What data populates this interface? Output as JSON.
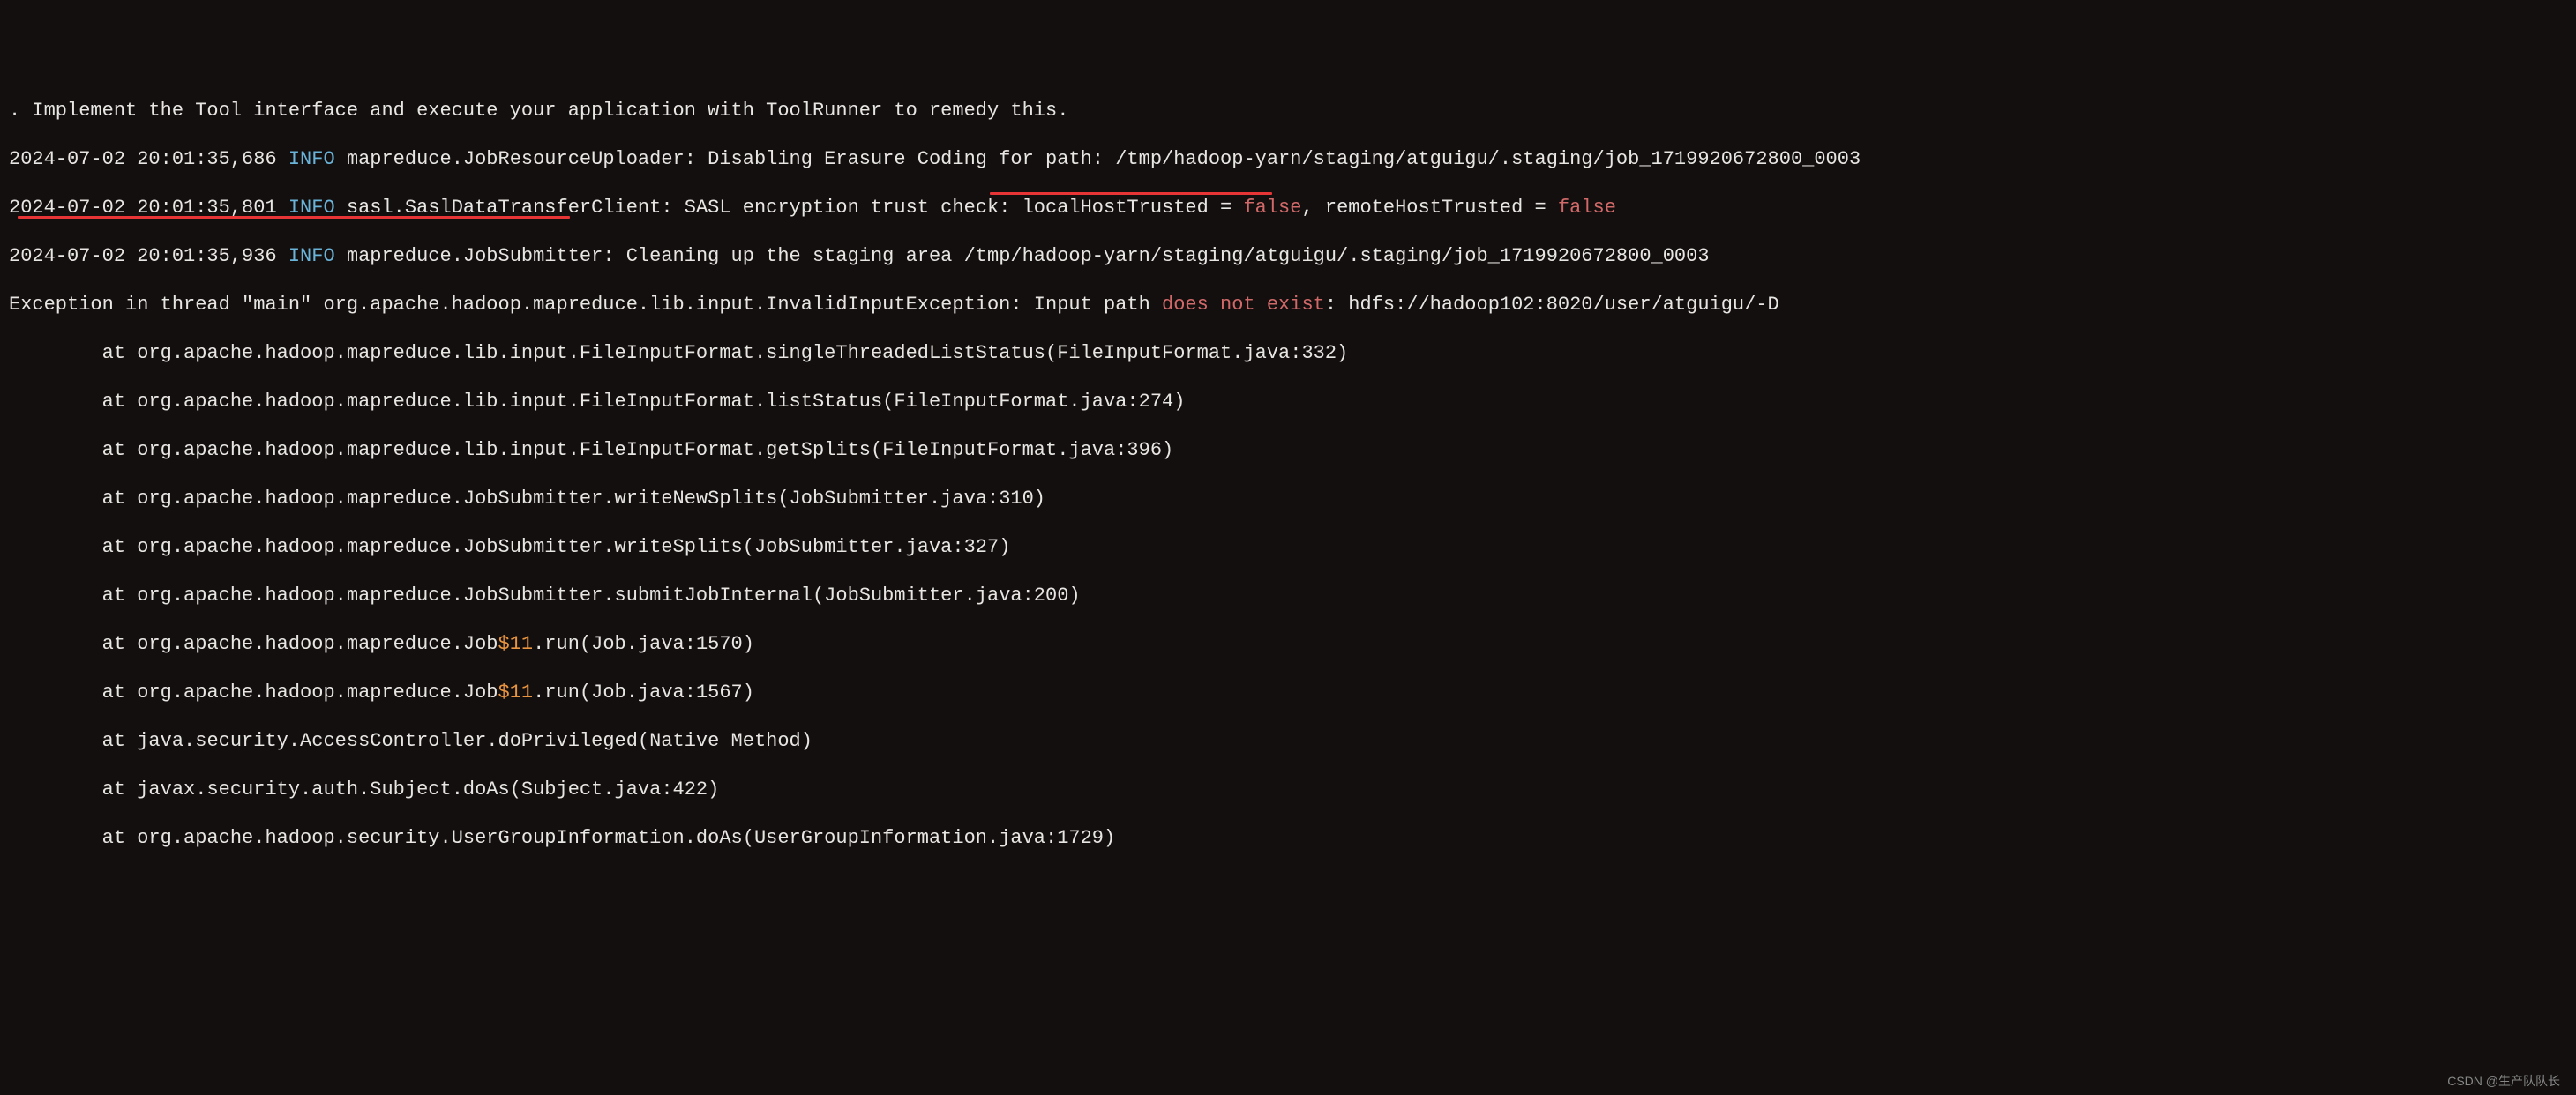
{
  "lines": {
    "l0": ". Implement the Tool interface and execute your application with ToolRunner to remedy this.",
    "l1_ts": "2024-07-02 20:01:35,686 ",
    "l1_level": "INFO",
    "l1_msg": " mapreduce.JobResourceUploader: Disabling Erasure Coding for path: /tmp/hadoop-yarn/staging/atguigu/.staging/job_1719920672800_0003",
    "l2_ts": "2024-07-02 20:01:35,801 ",
    "l2_level": "INFO",
    "l2_msg_a": " sasl.SaslDataTransferClient: SASL encryption trust check: localHostTrusted = ",
    "l2_false1": "false",
    "l2_msg_b": ", remoteHostTrusted = ",
    "l2_false2": "false",
    "l3_ts": "2024-07-02 20:01:35,936 ",
    "l3_level": "INFO",
    "l3_msg": " mapreduce.JobSubmitter: Cleaning up the staging area /tmp/hadoop-yarn/staging/atguigu/.staging/job_1719920672800_0003",
    "l4_a": "Exception in thread \"main\" org.apache.hadoop.mapreduce.lib.input.InvalidInputException: Input path ",
    "l4_b": "does not exist",
    "l4_c": ": hdfs://hadoop102:8020/user/atguigu/-D",
    "st0": "        at org.apache.hadoop.mapreduce.lib.input.FileInputFormat.singleThreadedListStatus(FileInputFormat.java:332)",
    "st1": "        at org.apache.hadoop.mapreduce.lib.input.FileInputFormat.listStatus(FileInputFormat.java:274)",
    "st2": "        at org.apache.hadoop.mapreduce.lib.input.FileInputFormat.getSplits(FileInputFormat.java:396)",
    "st3": "        at org.apache.hadoop.mapreduce.JobSubmitter.writeNewSplits(JobSubmitter.java:310)",
    "st4": "        at org.apache.hadoop.mapreduce.JobSubmitter.writeSplits(JobSubmitter.java:327)",
    "st5": "        at org.apache.hadoop.mapreduce.JobSubmitter.submitJobInternal(JobSubmitter.java:200)",
    "st6a": "        at org.apache.hadoop.mapreduce.Job",
    "st6b": "$11",
    "st6c": ".run(Job.java:1570)",
    "st7a": "        at org.apache.hadoop.mapreduce.Job",
    "st7b": "$11",
    "st7c": ".run(Job.java:1567)",
    "st8": "        at java.security.AccessController.doPrivileged(Native Method)",
    "st9": "        at javax.security.auth.Subject.doAs(Subject.java:422)",
    "st10": "        at org.apache.hadoop.security.UserGroupInformation.doAs(UserGroupInformation.java:1729)"
  },
  "watermark": "CSDN @生产队队长"
}
